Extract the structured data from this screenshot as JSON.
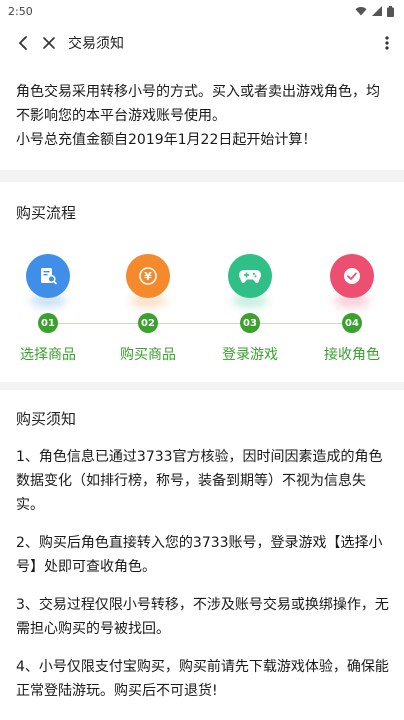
{
  "status_bar": {
    "time": "2:50"
  },
  "nav": {
    "title": "交易须知"
  },
  "intro": {
    "line1": "角色交易采用转移小号的方式。买入或者卖出游戏角色，均不影响您的本平台游戏账号使用。",
    "line2": "小号总充值金额自2019年1月22日起开始计算！"
  },
  "flow": {
    "title": "购买流程",
    "steps": [
      {
        "num": "01",
        "label": "选择商品",
        "color": "#3f8ee8"
      },
      {
        "num": "02",
        "label": "购买商品",
        "color": "#f58a2c"
      },
      {
        "num": "03",
        "label": "登录游戏",
        "color": "#2fbf87"
      },
      {
        "num": "04",
        "label": "接收角色",
        "color": "#ec4f6f"
      }
    ],
    "symbol_yen": "¥"
  },
  "notice": {
    "title": "购买须知",
    "items": [
      "1、角色信息已通过3733官方核验，因时间因素造成的角色数据变化（如排行榜，称号，装备到期等）不视为信息失实。",
      "2、购买后角色直接转入您的3733账号，登录游戏【选择小号】处即可查收角色。",
      "3、交易过程仅限小号转移，不涉及账号交易或换绑操作，无需担心购买的号被找回。",
      "4、小号仅限支付宝购买，购买前请先下载游戏体验，确保能正常登陆游玩。购买后不可退货!"
    ]
  }
}
